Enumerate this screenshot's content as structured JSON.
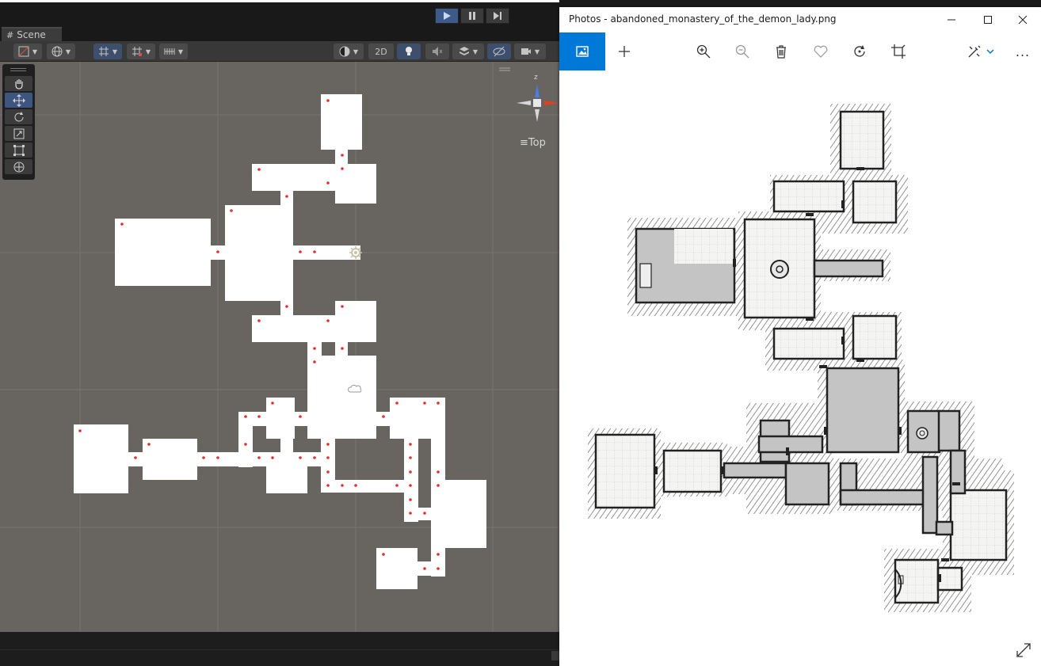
{
  "unity": {
    "playbar": {
      "play": "play-icon",
      "pause": "pause-icon",
      "step": "step-icon"
    },
    "scene_tab_label": "Scene",
    "toolbar": {
      "mode_2d": "2D"
    },
    "gizmo": {
      "view_label": "Top",
      "axis_label": "z"
    },
    "tools": [
      "hand-tool",
      "move-tool",
      "rotate-tool",
      "scale-tool",
      "rect-tool",
      "transform-tool"
    ],
    "colors": {
      "scene_bg": "#686460",
      "room_fill": "#ffffff",
      "marker": "#e03030",
      "grid": "#7a7672"
    }
  },
  "photos": {
    "title": "Photos - abandoned_monastery_of_the_demon_lady.png",
    "toolbar": {
      "view": "image-icon",
      "add": "plus-icon",
      "zoom_in": "zoom-in-icon",
      "zoom_out": "zoom-out-icon",
      "delete": "trash-icon",
      "favorite": "heart-icon",
      "rotate": "rotate-icon",
      "crop": "crop-icon",
      "edit": "edit-icon",
      "more": "..."
    },
    "colors": {
      "accent": "#0078d7"
    }
  }
}
